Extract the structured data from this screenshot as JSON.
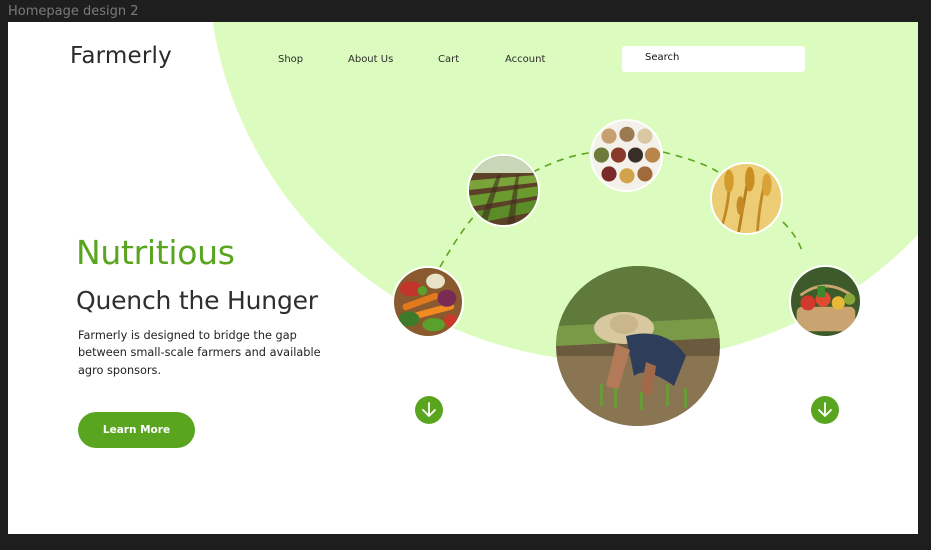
{
  "frame": {
    "label": "Homepage design 2"
  },
  "brand": {
    "name": "Farmerly"
  },
  "nav": {
    "items": [
      {
        "label": "Shop"
      },
      {
        "label": "About Us"
      },
      {
        "label": "Cart"
      },
      {
        "label": "Account"
      }
    ]
  },
  "search": {
    "label": "Search"
  },
  "hero": {
    "headline": "Nutritious",
    "subheadline": "Quench the Hunger",
    "description": "Farmerly is designed to bridge the gap between small-scale farmers and available agro sponsors.",
    "cta_label": "Learn More"
  },
  "colors": {
    "accent": "#5aa51f",
    "blob": "#dcfcbf",
    "frame_bg": "#1e1e1e"
  },
  "images": [
    {
      "name": "vegetables-photo"
    },
    {
      "name": "crop-field-photo"
    },
    {
      "name": "grains-seeds-photo"
    },
    {
      "name": "wheat-photo"
    },
    {
      "name": "produce-basket-photo"
    },
    {
      "name": "rice-farmer-photo"
    }
  ],
  "icons": {
    "scroll_down": "arrow-down-circle-icon"
  }
}
